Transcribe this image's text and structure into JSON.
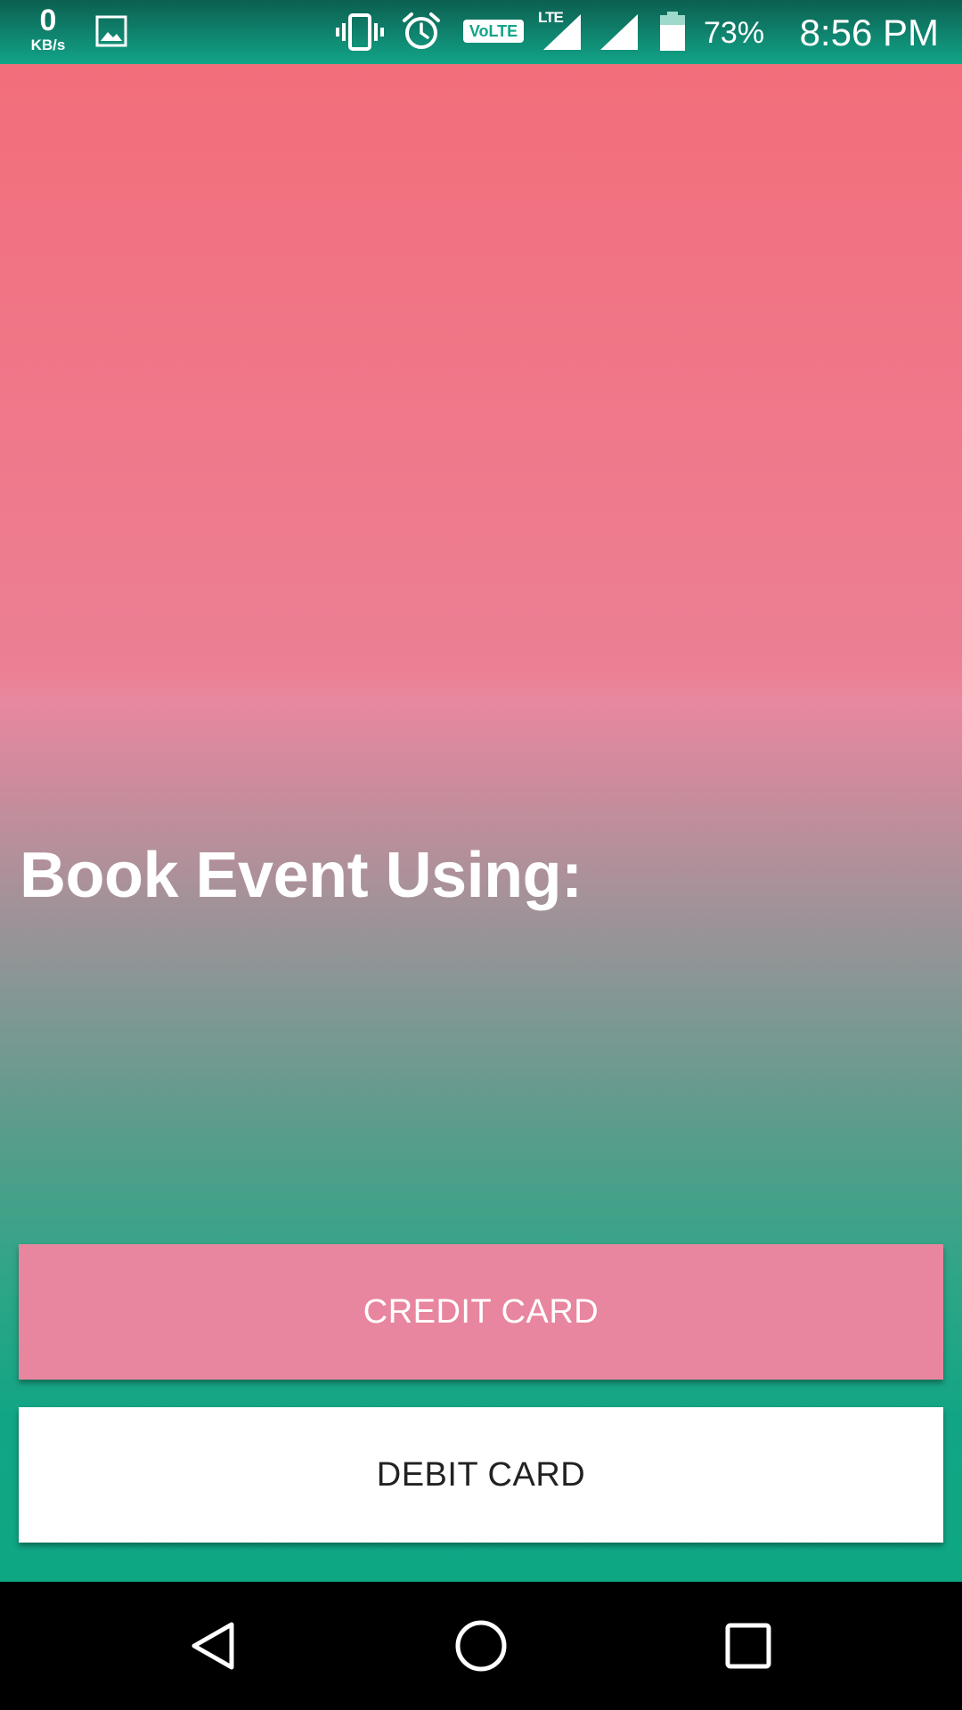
{
  "status_bar": {
    "net_speed_value": "0",
    "net_speed_unit": "KB/s",
    "volte_label": "VoLTE",
    "lte_label": "LTE",
    "battery_percent": "73%",
    "time": "8:56 PM",
    "icons": [
      "image-icon",
      "vibrate-icon",
      "alarm-icon",
      "volte-icon",
      "lte-signal-icon",
      "signal-icon",
      "battery-icon"
    ]
  },
  "main": {
    "title": "Book Event Using:",
    "credit_button_label": "CREDIT CARD",
    "debit_button_label": "DEBIT CARD"
  },
  "nav_bar": {
    "icons": [
      "back-icon",
      "home-icon",
      "recents-icon"
    ]
  },
  "colors": {
    "status_bar": "#12a488",
    "gradient_top": "#f36e7b",
    "gradient_mid": "#e8889f",
    "gradient_bottom": "#0ea784",
    "credit_button": "#e8869f",
    "debit_button": "#ffffff",
    "nav_bar": "#000000"
  }
}
